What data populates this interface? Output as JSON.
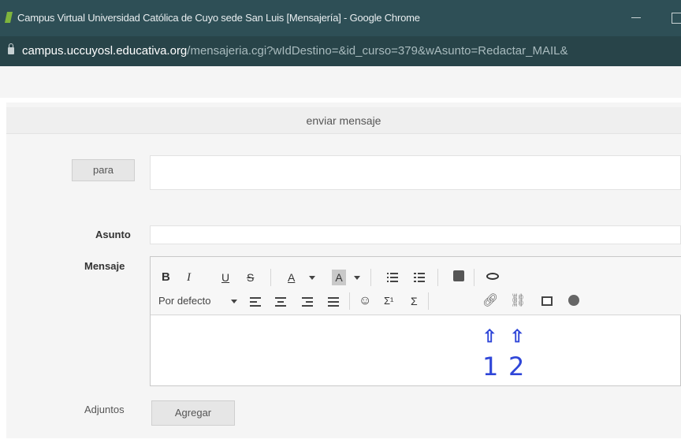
{
  "window": {
    "title": "Campus Virtual Universidad Católica de Cuyo sede San Luis [Mensajería] - Google Chrome"
  },
  "address": {
    "host": "campus.uccuyosl.educativa.org",
    "path": "/mensajeria.cgi?wIdDestino=&id_curso=379&wAsunto=Redactar_MAIL&"
  },
  "compose": {
    "header": "enviar mensaje",
    "para_label": "para",
    "asunto_label": "Asunto",
    "mensaje_label": "Mensaje",
    "adjuntos_label": "Adjuntos",
    "agregar_label": "Agregar"
  },
  "toolbar": {
    "bold": "B",
    "italic": "I",
    "underline": "U",
    "strike": "S",
    "font_color": "A",
    "bg_color": "A",
    "format_select": "Por defecto",
    "superscript": "Σ¹",
    "sum": "Σ"
  },
  "annotations": {
    "one": "1",
    "two": "2"
  },
  "colors": {
    "titlebar": "#2e4f56",
    "addressbar": "#284449",
    "annotation": "#2f46d8"
  }
}
